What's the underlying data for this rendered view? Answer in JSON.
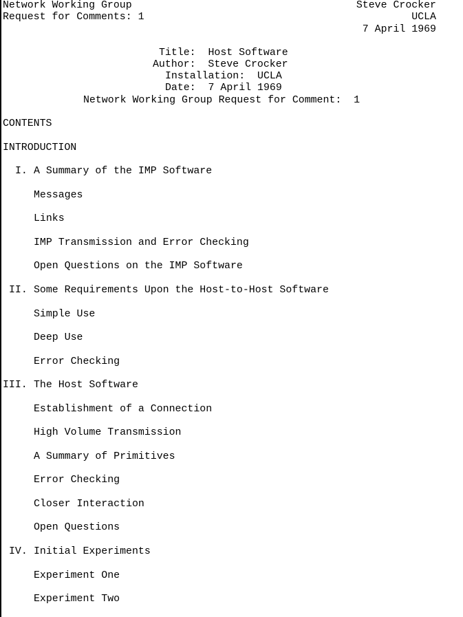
{
  "header": {
    "left_line1": "Network Working Group",
    "left_line2": "Request for Comments: 1",
    "right_line1": "Steve Crocker",
    "right_line2": "UCLA",
    "right_line3": "7 April 1969"
  },
  "titleblock": {
    "title_line": "Title:  Host Software",
    "author_line": "Author:  Steve Crocker",
    "installation_line": "Installation:  UCLA",
    "date_line": "Date:  7 April 1969",
    "rfc_line": "Network Working Group Request for Comment:  1"
  },
  "contents": {
    "heading": "CONTENTS",
    "introduction": "INTRODUCTION",
    "sections": [
      {
        "numeral": "I.",
        "title": "A Summary of the IMP Software",
        "items": [
          "Messages",
          "Links",
          "IMP Transmission and Error Checking",
          "Open Questions on the IMP Software"
        ]
      },
      {
        "numeral": "II.",
        "title": "Some Requirements Upon the Host-to-Host Software",
        "items": [
          "Simple Use",
          "Deep Use",
          "Error Checking"
        ]
      },
      {
        "numeral": "III.",
        "title": "The Host Software",
        "items": [
          "Establishment of a Connection",
          "High Volume Transmission",
          "A Summary of Primitives",
          "Error Checking",
          "Closer Interaction",
          "Open Questions"
        ]
      },
      {
        "numeral": "IV.",
        "title": "Initial Experiments",
        "items": [
          "Experiment One",
          "Experiment Two"
        ]
      }
    ]
  }
}
